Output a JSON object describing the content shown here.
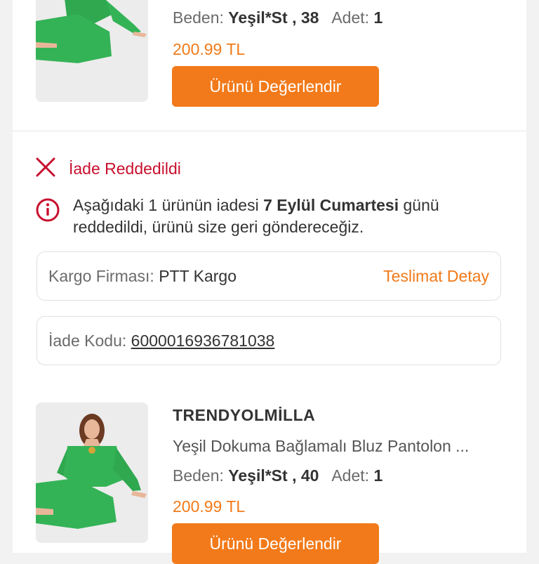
{
  "colors": {
    "accent": "#f27a1a",
    "error": "#c8102e",
    "background": "#f2f2f2"
  },
  "top_item": {
    "size_label": "Beden:",
    "size_value": "Yeşil*St , 38",
    "qty_label": "Adet:",
    "qty_value": "1",
    "price": "200.99 TL",
    "review_button": "Ürünü Değerlendir"
  },
  "return_section": {
    "status_icon": "close-x-icon",
    "status": "İade Reddedildi",
    "info_icon": "info-circle-icon",
    "info_text_1": "Aşağıdaki 1 ürünün iadesi",
    "info_text_bold": "7 Eylül Cumartesi",
    "info_text_2": "günü reddedildi, ürünü size geri göndereceğiz.",
    "cargo_label": "Kargo Firması:",
    "cargo_value": "PTT Kargo",
    "delivery_detail": "Teslimat Detay",
    "return_code_label": "İade Kodu:",
    "return_code": "6000016936781038"
  },
  "product": {
    "brand": "TRENDYOLMİLLA",
    "name": "Yeşil Dokuma Bağlamalı Bluz Pantolon ...",
    "size_label": "Beden:",
    "size_value": "Yeşil*St , 40",
    "qty_label": "Adet:",
    "qty_value": "1",
    "price": "200.99 TL",
    "review_button": "Ürünü Değerlendir"
  }
}
